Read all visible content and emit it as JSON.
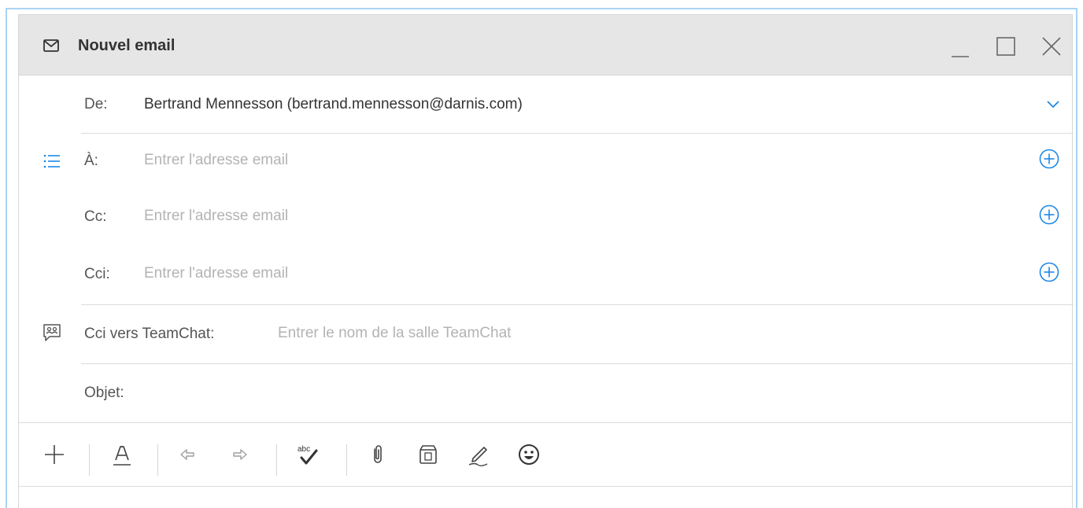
{
  "window": {
    "title": "Nouvel email",
    "controls": {
      "minimize_icon": "minimize-icon",
      "maximize_icon": "maximize-icon",
      "close_icon": "close-icon"
    }
  },
  "form": {
    "from": {
      "label": "De:",
      "value": "Bertrand Mennesson (bertrand.mennesson@darnis.com)"
    },
    "to": {
      "label": "À:",
      "placeholder": "Entrer l'adresse email"
    },
    "cc": {
      "label": "Cc:",
      "placeholder": "Entrer l'adresse email"
    },
    "bcc": {
      "label": "Cci:",
      "placeholder": "Entrer l'adresse email"
    },
    "teamchat": {
      "label": "Cci vers TeamChat:",
      "placeholder": "Entrer le nom de la salle TeamChat"
    },
    "subject": {
      "label": "Objet:",
      "placeholder": ""
    }
  },
  "toolbar": {
    "items": [
      "plus-icon",
      "text-format-icon",
      "undo-icon",
      "redo-icon",
      "spellcheck-icon",
      "attachment-icon",
      "insert-file-icon",
      "signature-icon",
      "emoji-icon"
    ],
    "spellcheck_text": "abc"
  },
  "colors": {
    "accent": "#1e88e5",
    "titlebar": "#e6e6e6",
    "window_border": "#a9d4f5",
    "placeholder": "#b3b3b3"
  }
}
